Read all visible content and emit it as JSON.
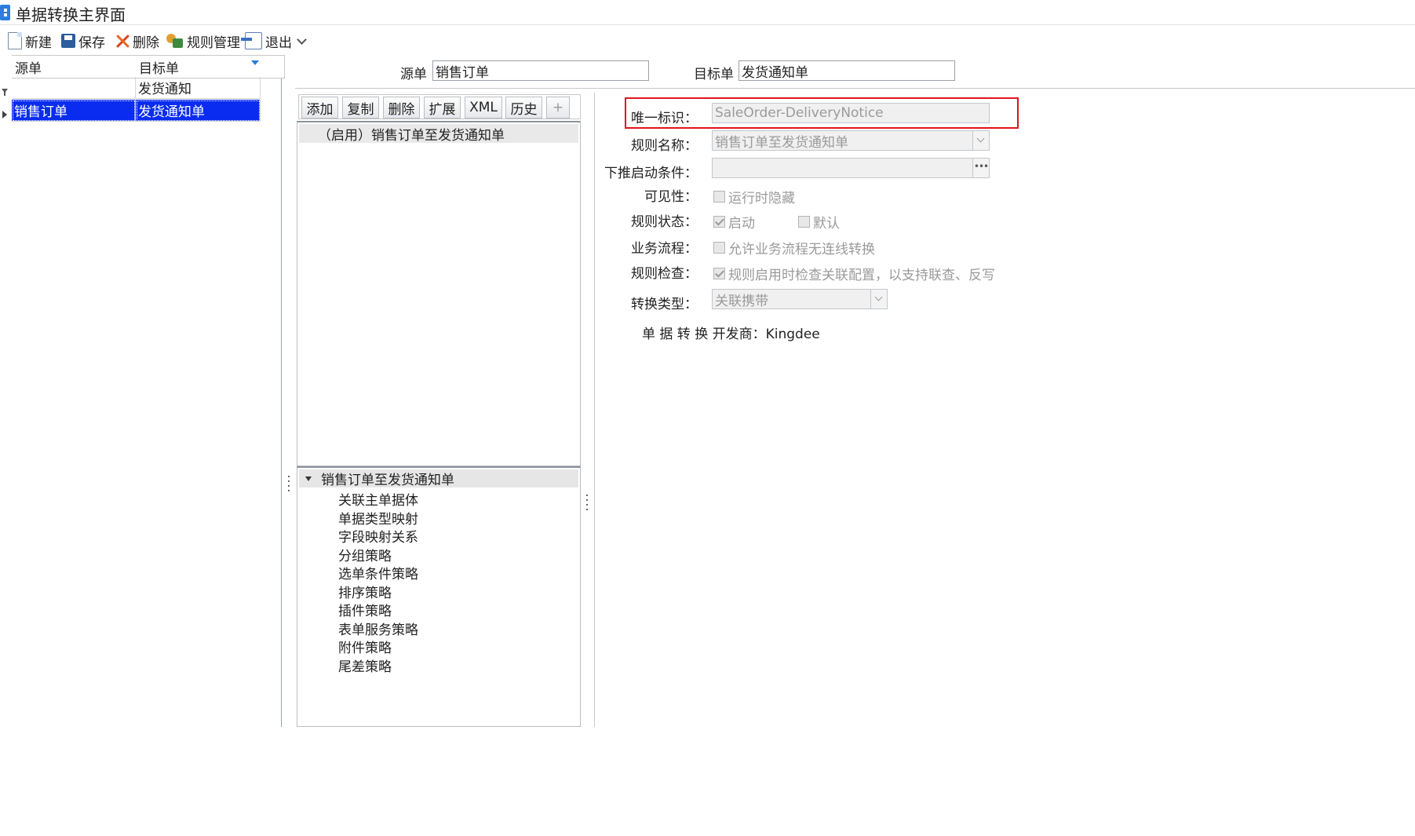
{
  "window": {
    "title": "单据转换主界面"
  },
  "toolbar": {
    "new_label": "新建",
    "save_label": "保存",
    "delete_label": "删除",
    "rules_label": "规则管理",
    "exit_label": "退出"
  },
  "grid": {
    "headers": {
      "source": "源单",
      "target": "目标单"
    },
    "filter_row": {
      "source": "",
      "target": "发货通知"
    },
    "rows": [
      {
        "source": "销售订单",
        "target": "发货通知单"
      }
    ]
  },
  "header_fields": {
    "source_label": "源单",
    "source_value": "销售订单",
    "target_label": "目标单",
    "target_value": "发货通知单"
  },
  "mid_buttons": {
    "add": "添加",
    "copy": "复制",
    "delete": "删除",
    "extend": "扩展",
    "xml": "XML",
    "history": "历史",
    "plus": "+"
  },
  "rule_list": {
    "item": "（启用）销售订单至发货通知单"
  },
  "tree": {
    "root": "销售订单至发货通知单",
    "children": [
      "关联主单据体",
      "单据类型映射",
      "字段映射关系",
      "分组策略",
      "选单条件策略",
      "排序策略",
      "插件策略",
      "表单服务策略",
      "附件策略",
      "尾差策略"
    ]
  },
  "form": {
    "unique_id_label": "唯一标识：",
    "unique_id_value": "SaleOrder-DeliveryNotice",
    "rule_name_label": "规则名称：",
    "rule_name_value": "销售订单至发货通知单",
    "push_condition_label": "下推启动条件：",
    "push_condition_value": "",
    "visibility_label": "可见性：",
    "visibility_option": "运行时隐藏",
    "visibility_checked": false,
    "rule_status_label": "规则状态：",
    "status_enabled": "启动",
    "status_enabled_checked": true,
    "status_default": "默认",
    "status_default_checked": false,
    "business_flow_label": "业务流程：",
    "business_flow_option": "允许业务流程无连线转换",
    "business_flow_checked": false,
    "rule_check_label": "规则检查：",
    "rule_check_option": "规则启用时检查关联配置，以支持联查、反写",
    "rule_check_checked": true,
    "convert_type_label": "转换类型：",
    "convert_type_value": "关联携带",
    "developer_label": "单 据 转 换 开发商：",
    "developer_value": "Kingdee"
  },
  "colors": {
    "selection": "#0a2cf0",
    "highlight_border": "#e0141c",
    "accent": "#2b7de0"
  }
}
